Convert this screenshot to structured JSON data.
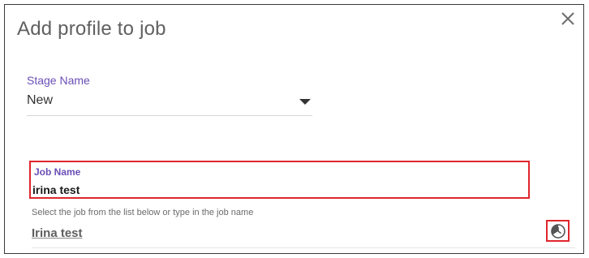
{
  "dialog": {
    "title": "Add profile to job",
    "close_icon": "close-icon"
  },
  "stage": {
    "label": "Stage Name",
    "selected_value": "New",
    "dropdown_icon": "chevron-down-icon"
  },
  "job": {
    "label": "Job Name",
    "value": "irina test",
    "helper_text": "Select the job from the list below or type in the job name",
    "suggestion": "Irina test",
    "history_icon": "history-icon"
  },
  "colors": {
    "accent": "#6a4fb6",
    "highlight": "#e0262c",
    "title": "#606060"
  }
}
